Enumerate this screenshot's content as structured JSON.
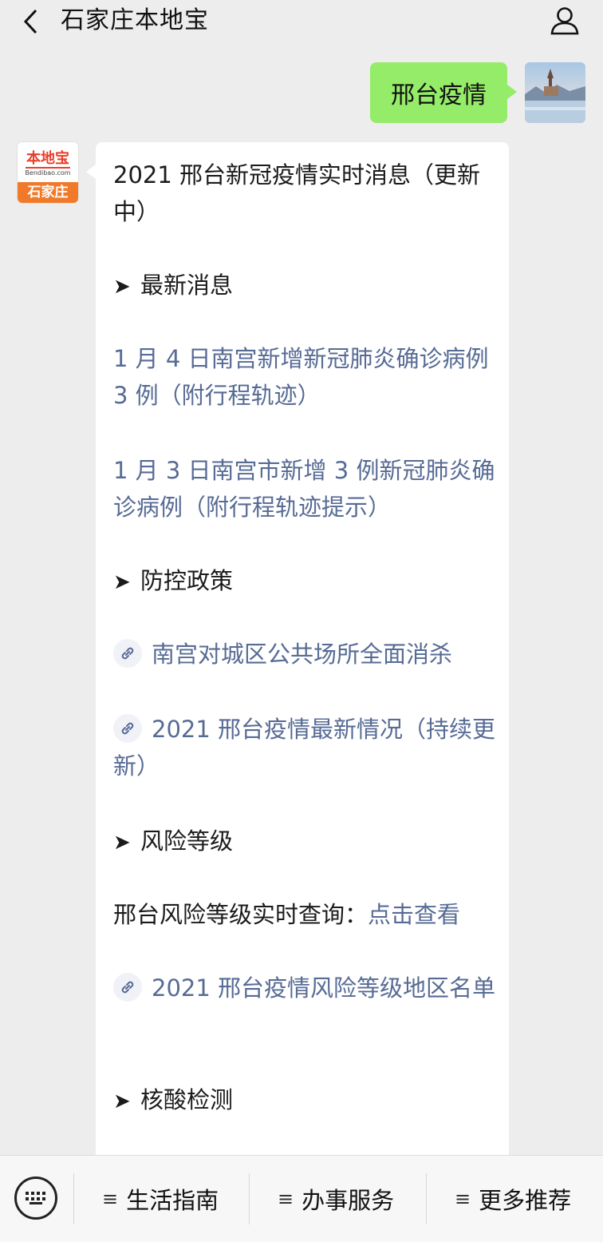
{
  "header": {
    "title": "石家庄本地宝"
  },
  "user_message": {
    "text": "邢台疫情"
  },
  "bot_avatar": {
    "brand": "本地宝",
    "url": "Bendibao.com",
    "city": "石家庄"
  },
  "bot_message": {
    "title": "2021 邢台新冠疫情实时消息（更新中）",
    "arrow": "➤",
    "sections": {
      "latest": "最新消息",
      "policy": "防控政策",
      "risk": "风险等级",
      "nucleic": "核酸检测"
    },
    "latest_links": [
      "1 月 4 日南宫新增新冠肺炎确诊病例 3 例（附行程轨迹）",
      "1 月 3 日南宫市新增 3 例新冠肺炎确诊病例（附行程轨迹提示）"
    ],
    "policy_links": [
      "南宫对城区公共场所全面消杀",
      "2021 邢台疫情最新情况（持续更新）"
    ],
    "risk_query_label": "邢台风险等级实时查询：",
    "risk_query_link": "点击查看",
    "risk_link": "2021 邢台疫情风险等级地区名单"
  },
  "bottom_menu": {
    "hamburger": "≡",
    "items": [
      "生活指南",
      "办事服务",
      "更多推荐"
    ]
  },
  "colors": {
    "bubble_green": "#95ec69",
    "link_blue": "#576b95",
    "background": "#ededed"
  }
}
